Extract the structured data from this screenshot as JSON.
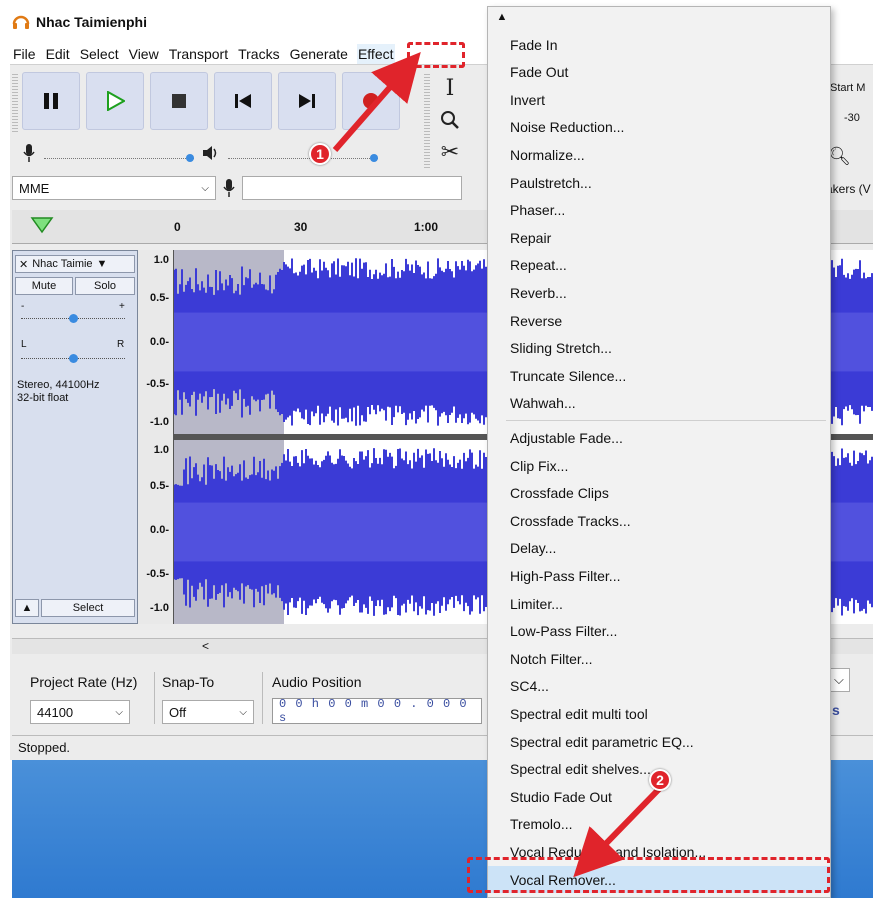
{
  "app": {
    "title": "Nhac Taimienphi",
    "icon": "headphones-icon"
  },
  "menubar": [
    "File",
    "Edit",
    "Select",
    "View",
    "Transport",
    "Tracks",
    "Generate",
    "Effect"
  ],
  "device": {
    "host": "MME",
    "output_partial": "akers (V"
  },
  "toolbar_right": {
    "label": "Start M",
    "value": "-30"
  },
  "ruler": {
    "ticks": [
      "0",
      "30",
      "1:00"
    ]
  },
  "track": {
    "name": "Nhac Taimie",
    "mute_label": "Mute",
    "solo_label": "Solo",
    "gain_minus": "-",
    "gain_plus": "+",
    "pan_left": "L",
    "pan_right": "R",
    "info_line1": "Stereo, 44100Hz",
    "info_line2": "32-bit float",
    "select_label": "Select",
    "scale_top": [
      "1.0",
      "0.5-",
      "0.0-",
      "-0.5-",
      "-1.0"
    ],
    "scale_bottom": [
      "1.0",
      "0.5-",
      "0.0-",
      "-0.5-",
      "-1.0"
    ]
  },
  "selection_bar": {
    "project_rate_label": "Project Rate (Hz)",
    "project_rate_value": "44100",
    "snap_to_label": "Snap-To",
    "snap_to_value": "Off",
    "audio_position_label": "Audio Position",
    "audio_position_value": "0 0 h 0 0 m 0 0 . 0 0 0 s",
    "right_fragment": "s"
  },
  "status": "Stopped.",
  "effect_menu": {
    "group1": [
      "Fade In",
      "Fade Out",
      "Invert",
      "Noise Reduction...",
      "Normalize...",
      "Paulstretch...",
      "Phaser...",
      "Repair",
      "Repeat...",
      "Reverb...",
      "Reverse",
      "Sliding Stretch...",
      "Truncate Silence...",
      "Wahwah..."
    ],
    "group2": [
      "Adjustable Fade...",
      "Clip Fix...",
      "Crossfade Clips",
      "Crossfade Tracks...",
      "Delay...",
      "High-Pass Filter...",
      "Limiter...",
      "Low-Pass Filter...",
      "Notch Filter...",
      "SC4...",
      "Spectral edit multi tool",
      "Spectral edit parametric EQ...",
      "Spectral edit shelves...",
      "Studio Fade Out",
      "Tremolo...",
      "Vocal Reduction and Isolation...",
      "Vocal Remover..."
    ],
    "highlighted": "Vocal Remover..."
  },
  "annotations": {
    "step1": "1",
    "step2": "2",
    "accent": "#e0242b"
  },
  "colors": {
    "waveform": "#3b3bd6",
    "waveform_selected_bg": "#b8b8c8",
    "track_bg": "#d8dfee"
  }
}
